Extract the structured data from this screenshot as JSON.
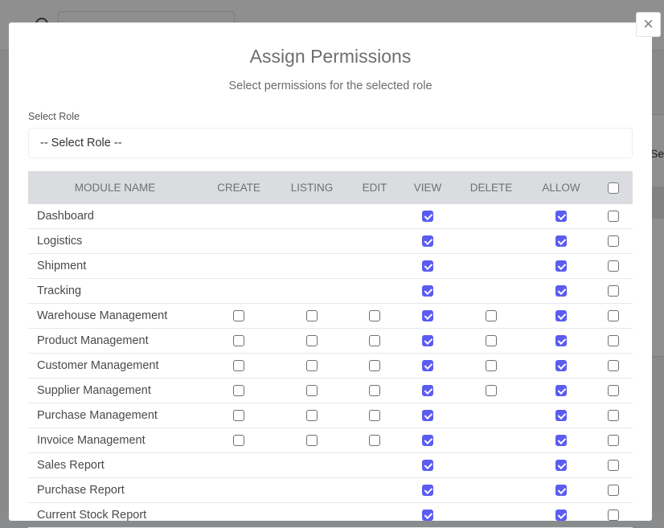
{
  "modal": {
    "title": "Assign Permissions",
    "subtitle": "Select permissions for the selected role",
    "close_label": "×",
    "role_label": "Select Role",
    "role_selected": "-- Select Role --"
  },
  "background": {
    "side_text": "Sea"
  },
  "table": {
    "headers": [
      "MODULE NAME",
      "CREATE",
      "LISTING",
      "EDIT",
      "VIEW",
      "DELETE",
      "ALLOW"
    ],
    "select_all_checked": false,
    "rows": [
      {
        "name": "Dashboard",
        "create": null,
        "listing": null,
        "edit": null,
        "view": true,
        "delete": null,
        "allow": true,
        "select": false
      },
      {
        "name": "Logistics",
        "create": null,
        "listing": null,
        "edit": null,
        "view": true,
        "delete": null,
        "allow": true,
        "select": false
      },
      {
        "name": "Shipment",
        "create": null,
        "listing": null,
        "edit": null,
        "view": true,
        "delete": null,
        "allow": true,
        "select": false
      },
      {
        "name": "Tracking",
        "create": null,
        "listing": null,
        "edit": null,
        "view": true,
        "delete": null,
        "allow": true,
        "select": false
      },
      {
        "name": "Warehouse Management",
        "create": false,
        "listing": false,
        "edit": false,
        "view": true,
        "delete": false,
        "allow": true,
        "select": false
      },
      {
        "name": "Product Management",
        "create": false,
        "listing": false,
        "edit": false,
        "view": true,
        "delete": false,
        "allow": true,
        "select": false
      },
      {
        "name": "Customer Management",
        "create": false,
        "listing": false,
        "edit": false,
        "view": true,
        "delete": false,
        "allow": true,
        "select": false
      },
      {
        "name": "Supplier Management",
        "create": false,
        "listing": false,
        "edit": false,
        "view": true,
        "delete": false,
        "allow": true,
        "select": false
      },
      {
        "name": "Purchase Management",
        "create": false,
        "listing": false,
        "edit": false,
        "view": true,
        "delete": null,
        "allow": true,
        "select": false
      },
      {
        "name": "Invoice Management",
        "create": false,
        "listing": false,
        "edit": false,
        "view": true,
        "delete": null,
        "allow": true,
        "select": false
      },
      {
        "name": "Sales Report",
        "create": null,
        "listing": null,
        "edit": null,
        "view": true,
        "delete": null,
        "allow": true,
        "select": false
      },
      {
        "name": "Purchase Report",
        "create": null,
        "listing": null,
        "edit": null,
        "view": true,
        "delete": null,
        "allow": true,
        "select": false
      },
      {
        "name": "Current Stock Report",
        "create": null,
        "listing": null,
        "edit": null,
        "view": true,
        "delete": null,
        "allow": true,
        "select": false
      }
    ]
  },
  "colors": {
    "checkbox_checked": "#5b5cf0",
    "header_bg": "#dadcdf"
  },
  "icons": {
    "close": "close-icon",
    "checkmark": "check-icon"
  }
}
